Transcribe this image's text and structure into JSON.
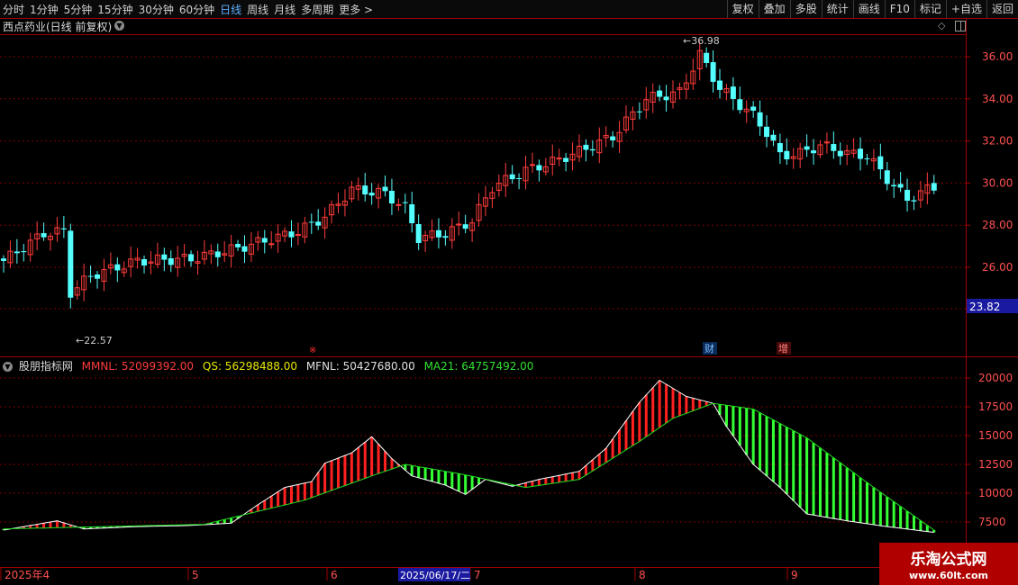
{
  "toolbar": {
    "periods": [
      "分时",
      "1分钟",
      "5分钟",
      "15分钟",
      "30分钟",
      "60分钟",
      "日线",
      "周线",
      "月线",
      "多周期",
      "更多 >"
    ],
    "active_period": "日线",
    "tools": [
      "复权",
      "叠加",
      "多股",
      "统计",
      "画线",
      "F10",
      "标记",
      "+自选",
      "返回"
    ]
  },
  "main_chart": {
    "title": "西点药业(日线 前复权)",
    "price_ticks": [
      "36.00",
      "34.00",
      "32.00",
      "30.00",
      "28.00",
      "26.00"
    ],
    "high_label": "36.98",
    "low_label": "22.57",
    "current_price": "23.82",
    "markers": {
      "cai": "财",
      "zeng": "增",
      "x": "※"
    },
    "colors": {
      "up": "#ff3c3c",
      "down": "#54ffff",
      "grid": "#7a0000",
      "border": "#a00000"
    }
  },
  "indicator": {
    "name": "股朋指标网",
    "mmnl_label": "MMNL: 52099392.00",
    "qs_label": "QS: 56298488.00",
    "mfnl_label": "MFNL: 50427680.00",
    "ma21_label": "MA21: 64757492.00",
    "ticks": [
      "20000",
      "17500",
      "15000",
      "12500",
      "10000",
      "7500"
    ],
    "colors": {
      "up": "#ff2020",
      "down": "#33ff33",
      "line": "#ffffff",
      "ma": "#20e020"
    }
  },
  "time_axis": {
    "labels": [
      "2025年4",
      "5",
      "6",
      "7",
      "8",
      "9"
    ],
    "cursor_date": "2025/06/17/二"
  },
  "watermark": {
    "line1": "乐淘公式网",
    "line2": "www.60lt.com"
  }
}
